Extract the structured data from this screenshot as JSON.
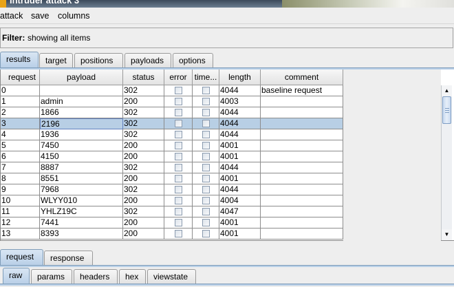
{
  "window": {
    "title": "Intruder attack 3"
  },
  "menu": {
    "attack": "attack",
    "save": "save",
    "columns": "columns"
  },
  "filter": {
    "label": "Filter:",
    "text": "showing all items"
  },
  "main_tabs": [
    "results",
    "target",
    "positions",
    "payloads",
    "options"
  ],
  "table": {
    "columns": [
      "request",
      "payload",
      "status",
      "error",
      "time...",
      "length",
      "comment"
    ],
    "selected_index": 3,
    "rows": [
      {
        "request": "0",
        "payload": "",
        "status": "302",
        "error": false,
        "timeout": false,
        "length": "4044",
        "comment": "baseline request"
      },
      {
        "request": "1",
        "payload": "admin",
        "status": "200",
        "error": false,
        "timeout": false,
        "length": "4003",
        "comment": ""
      },
      {
        "request": "2",
        "payload": "1866",
        "status": "302",
        "error": false,
        "timeout": false,
        "length": "4044",
        "comment": ""
      },
      {
        "request": "3",
        "payload": "2196",
        "status": "302",
        "error": false,
        "timeout": false,
        "length": "4044",
        "comment": ""
      },
      {
        "request": "4",
        "payload": "1936",
        "status": "302",
        "error": false,
        "timeout": false,
        "length": "4044",
        "comment": ""
      },
      {
        "request": "5",
        "payload": "7450",
        "status": "200",
        "error": false,
        "timeout": false,
        "length": "4001",
        "comment": ""
      },
      {
        "request": "6",
        "payload": "4150",
        "status": "200",
        "error": false,
        "timeout": false,
        "length": "4001",
        "comment": ""
      },
      {
        "request": "7",
        "payload": "8887",
        "status": "302",
        "error": false,
        "timeout": false,
        "length": "4044",
        "comment": ""
      },
      {
        "request": "8",
        "payload": "8551",
        "status": "200",
        "error": false,
        "timeout": false,
        "length": "4001",
        "comment": ""
      },
      {
        "request": "9",
        "payload": "7968",
        "status": "302",
        "error": false,
        "timeout": false,
        "length": "4044",
        "comment": ""
      },
      {
        "request": "10",
        "payload": "WLYY010",
        "status": "200",
        "error": false,
        "timeout": false,
        "length": "4004",
        "comment": ""
      },
      {
        "request": "11",
        "payload": "YHLZ19C",
        "status": "302",
        "error": false,
        "timeout": false,
        "length": "4047",
        "comment": ""
      },
      {
        "request": "12",
        "payload": "7441",
        "status": "200",
        "error": false,
        "timeout": false,
        "length": "4001",
        "comment": ""
      },
      {
        "request": "13",
        "payload": "8393",
        "status": "200",
        "error": false,
        "timeout": false,
        "length": "4001",
        "comment": ""
      }
    ]
  },
  "detail_tabs": [
    "request",
    "response"
  ],
  "view_tabs": [
    "raw",
    "params",
    "headers",
    "hex",
    "viewstate"
  ],
  "icons": {
    "scroll_up": "triangle-up-icon",
    "scroll_down": "triangle-down-icon"
  },
  "colors": {
    "selected_row": "#b8cfe5",
    "selected_tab": "#b8cfe7"
  }
}
